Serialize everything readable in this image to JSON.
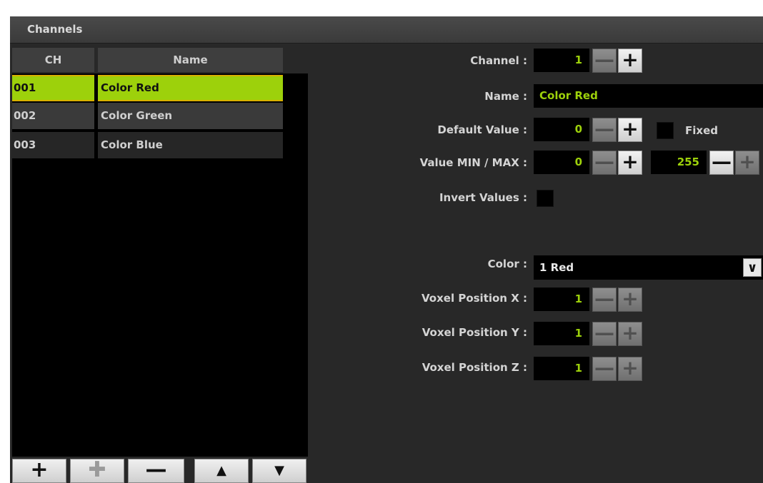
{
  "header": {
    "title": "Channels"
  },
  "table": {
    "col_ch": "CH",
    "col_name": "Name",
    "rows": [
      {
        "ch": "001",
        "name": "Color Red",
        "selected": true
      },
      {
        "ch": "002",
        "name": "Color Green",
        "selected": false
      },
      {
        "ch": "003",
        "name": "Color Blue",
        "selected": false
      }
    ]
  },
  "buttons": {
    "add": "+",
    "add_alt": "✚",
    "remove": "—",
    "up": "▲",
    "down": "▼"
  },
  "props": {
    "channel_label": "Channel :",
    "channel_value": "1",
    "name_label": "Name :",
    "name_value": "Color Red",
    "default_label": "Default Value :",
    "default_value": "0",
    "fixed_label": "Fixed",
    "minmax_label": "Value MIN / MAX :",
    "min_value": "0",
    "max_value": "255",
    "invert_label": "Invert Values :",
    "color_label": "Color :",
    "color_value": "1 Red",
    "voxel_x_label": "Voxel Position X :",
    "voxel_x_value": "1",
    "voxel_y_label": "Voxel Position Y :",
    "voxel_y_value": "1",
    "voxel_z_label": "Voxel Position Z :",
    "voxel_z_value": "1",
    "minus": "—",
    "plus": "+"
  },
  "colors": {
    "accent": "#9dd10b",
    "selection_border": "#d8b000",
    "panel_bg": "#282828",
    "field_bg": "#000000"
  },
  "icons": {
    "dropdown": "chevron-down-icon",
    "up": "arrow-up-icon",
    "down": "arrow-down-icon"
  }
}
